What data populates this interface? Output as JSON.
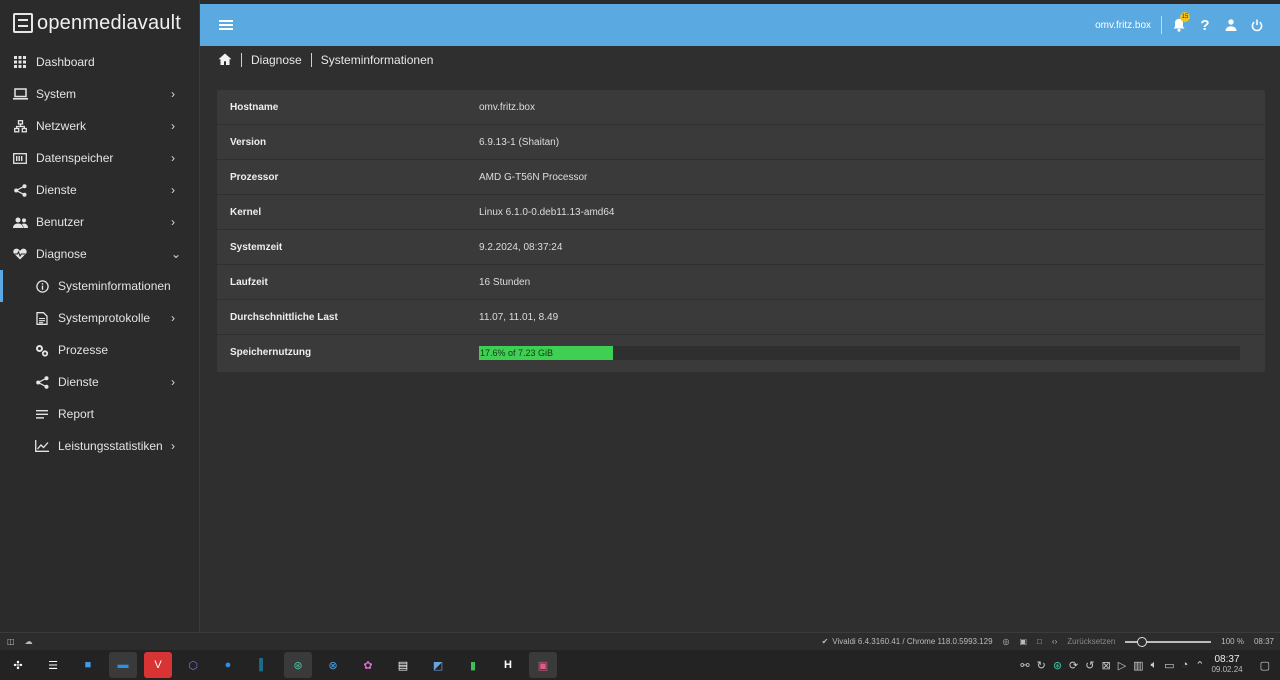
{
  "brand": {
    "name": "openmediavault"
  },
  "topbar": {
    "hostname": "omv.fritz.box",
    "notification_count": "15"
  },
  "breadcrumb": {
    "level1": "Diagnose",
    "level2": "Systeminformationen"
  },
  "sidebar": {
    "items": [
      {
        "label": "Dashboard",
        "icon": "grid-icon"
      },
      {
        "label": "System",
        "icon": "laptop-icon"
      },
      {
        "label": "Netzwerk",
        "icon": "network-icon"
      },
      {
        "label": "Datenspeicher",
        "icon": "storage-icon"
      },
      {
        "label": "Dienste",
        "icon": "share-icon"
      },
      {
        "label": "Benutzer",
        "icon": "users-icon"
      },
      {
        "label": "Diagnose",
        "icon": "heart-pulse-icon"
      },
      {
        "label": "Systeminformationen",
        "icon": "info-icon"
      },
      {
        "label": "Systemprotokolle",
        "icon": "log-icon"
      },
      {
        "label": "Prozesse",
        "icon": "cogs-icon"
      },
      {
        "label": "Dienste",
        "icon": "share-icon"
      },
      {
        "label": "Report",
        "icon": "report-icon"
      },
      {
        "label": "Leistungsstatistiken",
        "icon": "chart-icon"
      }
    ]
  },
  "info": {
    "rows": [
      {
        "key": "Hostname",
        "value": "omv.fritz.box"
      },
      {
        "key": "Version",
        "value": "6.9.13-1 (Shaitan)"
      },
      {
        "key": "Prozessor",
        "value": "AMD G-T56N Processor"
      },
      {
        "key": "Kernel",
        "value": "Linux 6.1.0-0.deb11.13-amd64"
      },
      {
        "key": "Systemzeit",
        "value": "9.2.2024, 08:37:24"
      },
      {
        "key": "Laufzeit",
        "value": "16 Stunden"
      },
      {
        "key": "Durchschnittliche Last",
        "value": "11.07, 11.01, 8.49"
      },
      {
        "key": "Speichernutzung",
        "value": "17.6% of 7.23 GiB"
      }
    ],
    "memory_used_fraction": 0.176,
    "memory_bar_color": "#3fcf52"
  },
  "statusbar": {
    "browser": "Vivaldi 6.4.3160.41 / Chrome 118.0.5993.129",
    "reset_label": "Zurücksetzen",
    "zoom": "100 %",
    "time": "08:37"
  },
  "taskbar": {
    "clock_time": "08:37",
    "clock_date": "09.02.24"
  },
  "colors": {
    "accent": "#5aa9e0",
    "active_marker": "#5aa9e6"
  }
}
